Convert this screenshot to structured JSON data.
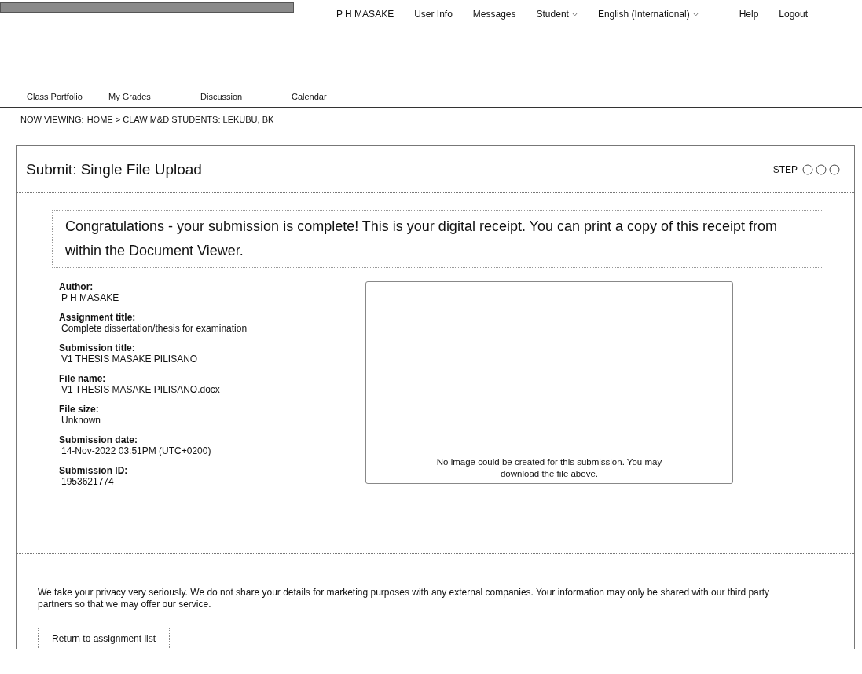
{
  "top_nav": {
    "items": [
      {
        "label": "P H MASAKE",
        "dropdown": false
      },
      {
        "label": "User Info",
        "dropdown": false
      },
      {
        "label": "Messages",
        "dropdown": false
      },
      {
        "label": "Student",
        "dropdown": true
      },
      {
        "label": "English (International)",
        "dropdown": true
      },
      {
        "label": "Help",
        "dropdown": false
      },
      {
        "label": "Logout",
        "dropdown": false
      }
    ]
  },
  "tabs": [
    {
      "label": "Class Portfolio"
    },
    {
      "label": "My Grades"
    },
    {
      "label": "Discussion"
    },
    {
      "label": "Calendar"
    }
  ],
  "breadcrumb": {
    "prefix": "NOW VIEWING:",
    "path": "HOME > CLAW M&D STUDENTS: LEKUBU, BK"
  },
  "panel": {
    "title": "Submit: Single File Upload",
    "step_label": "STEP",
    "message": "Congratulations - your submission is complete! This is your digital receipt. You can print a copy of this receipt from within the Document Viewer.",
    "details": [
      {
        "label": "Author:",
        "value": "P H MASAKE"
      },
      {
        "label": "Assignment title:",
        "value": "Complete dissertation/thesis for examination"
      },
      {
        "label": "Submission title:",
        "value": "V1 THESIS MASAKE PILISANO"
      },
      {
        "label": "File name:",
        "value": "V1 THESIS MASAKE PILISANO.docx"
      },
      {
        "label": "File size:",
        "value": "Unknown"
      },
      {
        "label": "Submission date:",
        "value": "14-Nov-2022 03:51PM (UTC+0200)"
      },
      {
        "label": "Submission ID:",
        "value": "1953621774"
      }
    ],
    "preview_note": "No image could be created for this submission. You may download the file above.",
    "privacy": "We take your privacy very seriously. We do not share your details for marketing purposes with any external companies. Your information may only be shared with our third party partners so that we may offer our service.",
    "return_button": "Return to assignment list"
  }
}
